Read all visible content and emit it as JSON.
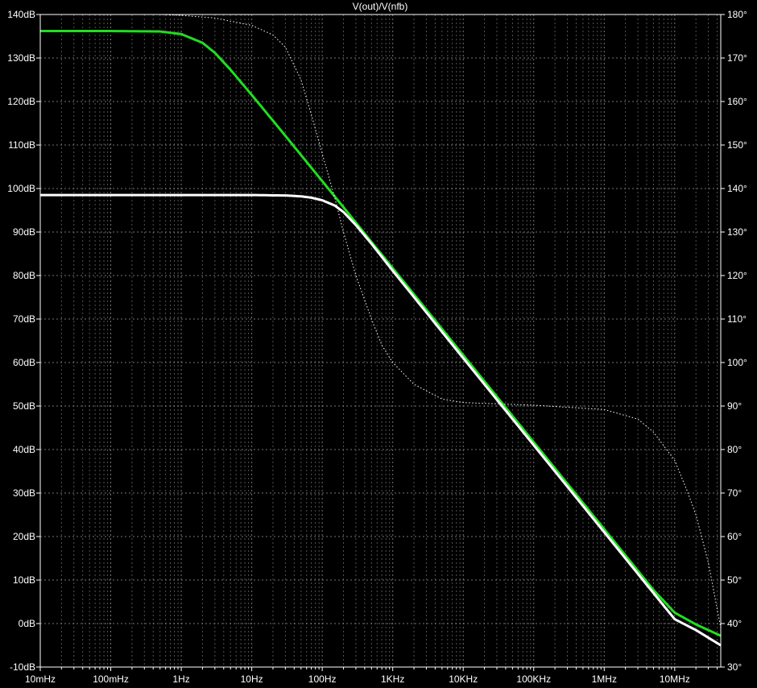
{
  "chart_data": {
    "type": "line",
    "title": "V(out)/V(nfb)",
    "x_scale": "log",
    "xlim": [
      0.01,
      45000000
    ],
    "x_ticks": [
      {
        "value": 0.01,
        "label": "10mHz"
      },
      {
        "value": 0.1,
        "label": "100mHz"
      },
      {
        "value": 1,
        "label": "1Hz"
      },
      {
        "value": 10,
        "label": "10Hz"
      },
      {
        "value": 100,
        "label": "100Hz"
      },
      {
        "value": 1000,
        "label": "1KHz"
      },
      {
        "value": 10000,
        "label": "10KHz"
      },
      {
        "value": 100000,
        "label": "100KHz"
      },
      {
        "value": 1000000,
        "label": "1MHz"
      },
      {
        "value": 10000000,
        "label": "10MHz"
      }
    ],
    "y_left": {
      "unit": "dB",
      "ylim": [
        -10,
        140
      ],
      "ticks": [
        {
          "value": 140,
          "label": "140dB"
        },
        {
          "value": 130,
          "label": "130dB"
        },
        {
          "value": 120,
          "label": "120dB"
        },
        {
          "value": 110,
          "label": "110dB"
        },
        {
          "value": 100,
          "label": "100dB"
        },
        {
          "value": 90,
          "label": "90dB"
        },
        {
          "value": 80,
          "label": "80dB"
        },
        {
          "value": 70,
          "label": "70dB"
        },
        {
          "value": 60,
          "label": "60dB"
        },
        {
          "value": 50,
          "label": "50dB"
        },
        {
          "value": 40,
          "label": "40dB"
        },
        {
          "value": 30,
          "label": "30dB"
        },
        {
          "value": 20,
          "label": "20dB"
        },
        {
          "value": 10,
          "label": "10dB"
        },
        {
          "value": 0,
          "label": "0dB"
        },
        {
          "value": -10,
          "label": "-10dB"
        }
      ]
    },
    "y_right": {
      "unit": "°",
      "ylim": [
        30,
        180
      ],
      "ticks": [
        {
          "value": 180,
          "label": "180°"
        },
        {
          "value": 170,
          "label": "170°"
        },
        {
          "value": 160,
          "label": "160°"
        },
        {
          "value": 150,
          "label": "150°"
        },
        {
          "value": 140,
          "label": "140°"
        },
        {
          "value": 130,
          "label": "130°"
        },
        {
          "value": 120,
          "label": "120°"
        },
        {
          "value": 110,
          "label": "110°"
        },
        {
          "value": 100,
          "label": "100°"
        },
        {
          "value": 90,
          "label": "90°"
        },
        {
          "value": 80,
          "label": "80°"
        },
        {
          "value": 70,
          "label": "70°"
        },
        {
          "value": 60,
          "label": "60°"
        },
        {
          "value": 50,
          "label": "50°"
        },
        {
          "value": 40,
          "label": "40°"
        },
        {
          "value": 30,
          "label": "30°"
        }
      ]
    },
    "grid": true,
    "background": "#000000",
    "series": [
      {
        "axis": "left",
        "color": "#22dd22",
        "style": "solid",
        "x": [
          0.01,
          0.1,
          0.5,
          1,
          2,
          3,
          5,
          10,
          20,
          50,
          100,
          200,
          500,
          1000,
          10000,
          100000,
          1000000,
          5000000,
          10000000,
          20000000,
          45000000
        ],
        "y": [
          136.2,
          136.2,
          136.1,
          135.5,
          133.5,
          131.2,
          127.3,
          121.5,
          115.6,
          107.7,
          101.7,
          95.7,
          87.7,
          81.7,
          61.7,
          41.7,
          21.7,
          7.7,
          2.5,
          -0.2,
          -2.8
        ]
      },
      {
        "axis": "left",
        "color": "#ffffff",
        "style": "solid",
        "x": [
          0.01,
          1,
          10,
          30,
          50,
          70,
          100,
          150,
          200,
          300,
          500,
          1000,
          10000,
          100000,
          1000000,
          5000000,
          10000000,
          20000000,
          45000000
        ],
        "y": [
          98.5,
          98.5,
          98.5,
          98.4,
          98.2,
          97.9,
          97.3,
          96.1,
          94.6,
          91.6,
          87.3,
          81.1,
          61.0,
          41.0,
          21.0,
          7.0,
          1.0,
          -1.5,
          -5.0
        ]
      },
      {
        "axis": "right",
        "color": "#ffffff",
        "style": "dotted",
        "x": [
          0.01,
          0.5,
          1,
          3,
          10,
          20,
          30,
          50,
          70,
          100,
          150,
          200,
          300,
          500,
          700,
          1000,
          2000,
          5000,
          10000,
          100000,
          1000000,
          3000000,
          5000000,
          10000000,
          15000000,
          20000000,
          30000000,
          45000000
        ],
        "y": [
          180,
          180,
          179.8,
          179.2,
          177.5,
          175.3,
          172.5,
          165,
          157,
          148,
          138,
          130,
          120,
          110,
          104,
          100,
          95,
          91.6,
          90.8,
          90.2,
          89.2,
          87,
          84,
          77.5,
          70.5,
          65,
          54,
          39
        ]
      }
    ]
  }
}
